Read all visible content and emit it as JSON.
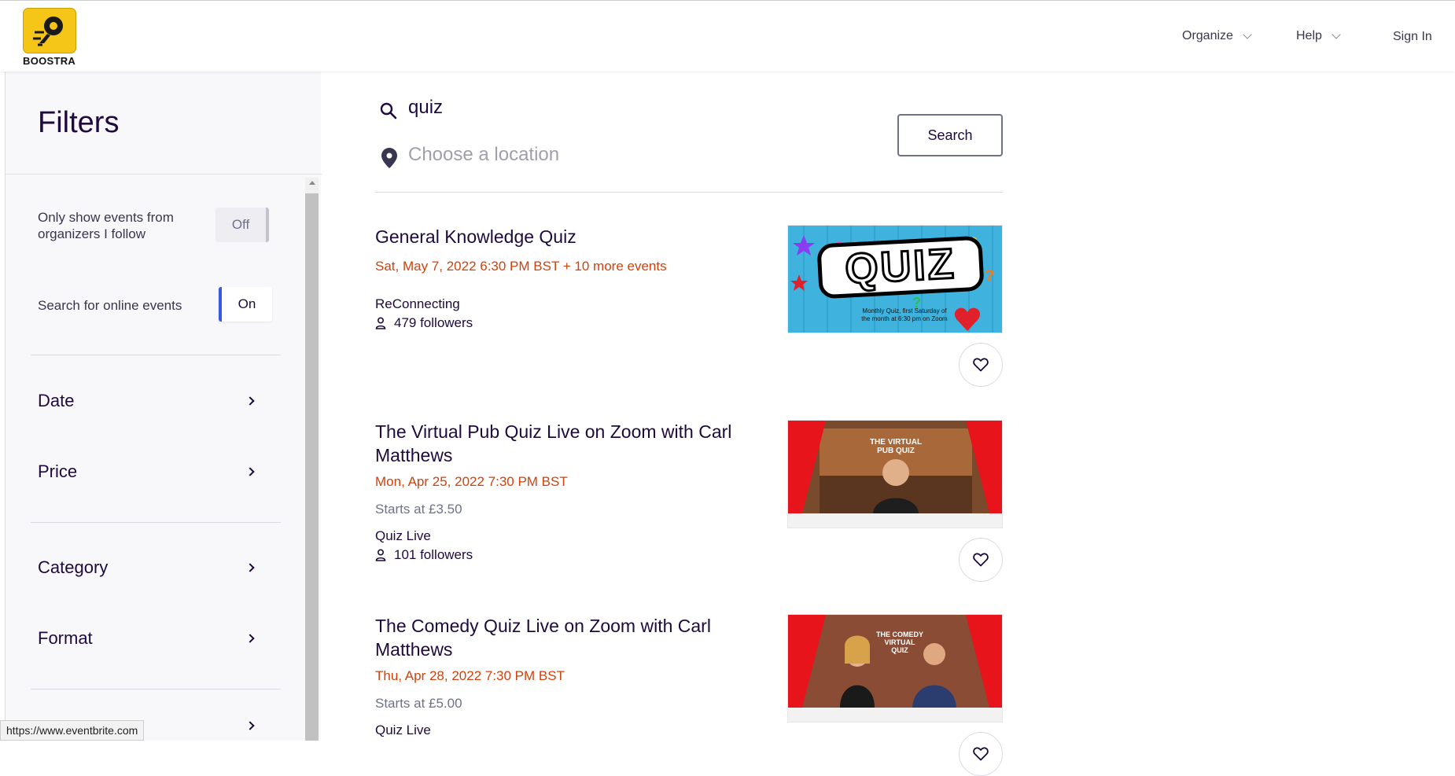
{
  "header": {
    "logo_text": "BOOSTRA",
    "nav": [
      {
        "label": "Organize",
        "dropdown": true
      },
      {
        "label": "Help",
        "dropdown": true
      },
      {
        "label": "Sign In",
        "dropdown": false
      }
    ]
  },
  "sidebar": {
    "title": "Filters",
    "toggles": [
      {
        "label": "Only show events from organizers I follow",
        "state": "Off"
      },
      {
        "label": "Search for online events",
        "state": "On"
      }
    ],
    "filters": [
      "Date",
      "Price",
      "Category",
      "Format"
    ]
  },
  "search": {
    "query": "quiz",
    "location_placeholder": "Choose a location",
    "button_label": "Search"
  },
  "events": [
    {
      "title": "General Knowledge Quiz",
      "date": "Sat, May 7, 2022 6:30 PM BST + 10 more events",
      "price": "",
      "organizer": "ReConnecting",
      "followers": "479 followers",
      "image_label": "QUIZ",
      "image_caption": "Monthly Quiz, first Saturday of the month at 6:30 pm on Zoom"
    },
    {
      "title": "The Virtual Pub Quiz Live on Zoom with Carl Matthews",
      "date": "Mon, Apr 25, 2022 7:30 PM BST",
      "price": "Starts at £3.50",
      "organizer": "Quiz Live",
      "followers": "101 followers",
      "image_label": "THE VIRTUAL PUB QUIZ"
    },
    {
      "title": "The Comedy Quiz Live on Zoom with Carl Matthews",
      "date": "Thu, Apr 28, 2022 7:30 PM BST",
      "price": "Starts at £5.00",
      "organizer": "Quiz Live",
      "image_label": "THE COMEDY VIRTUAL QUIZ"
    }
  ],
  "status_url": "https://www.eventbrite.com",
  "colors": {
    "accent": "#d1410c",
    "toggle_on": "#3659e3",
    "logo": "#f5c518"
  }
}
